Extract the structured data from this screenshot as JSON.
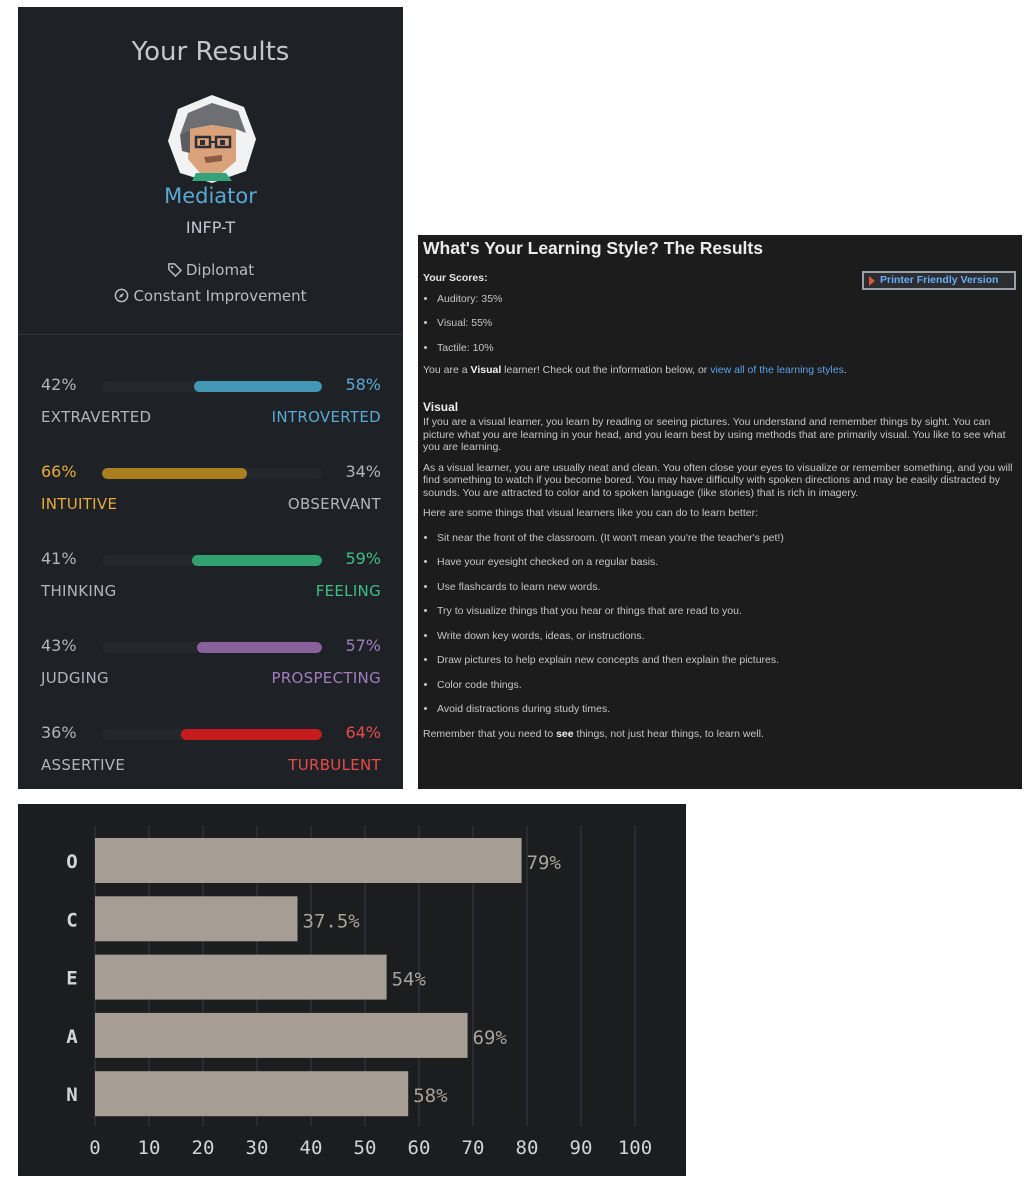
{
  "personality_card": {
    "title": "Your Results",
    "type_name": "Mediator",
    "type_code": "INFP-T",
    "role": "Diplomat",
    "strategy": "Constant Improvement",
    "traits": [
      {
        "left_pct": "42%",
        "right_pct": "58%",
        "left_label": "EXTRAVERTED",
        "right_label": "INTROVERTED",
        "dominant": "right",
        "value": 58,
        "color": "#4298b4"
      },
      {
        "left_pct": "66%",
        "right_pct": "34%",
        "left_label": "INTUITIVE",
        "right_label": "OBSERVANT",
        "dominant": "left",
        "value": 66,
        "color": "#a97f22"
      },
      {
        "left_pct": "41%",
        "right_pct": "59%",
        "left_label": "THINKING",
        "right_label": "FEELING",
        "dominant": "right",
        "value": 59,
        "color": "#31a26f"
      },
      {
        "left_pct": "43%",
        "right_pct": "57%",
        "left_label": "JUDGING",
        "right_label": "PROSPECTING",
        "dominant": "right",
        "value": 57,
        "color": "#88619a"
      },
      {
        "left_pct": "36%",
        "right_pct": "64%",
        "left_label": "ASSERTIVE",
        "right_label": "TURBULENT",
        "dominant": "right",
        "value": 64,
        "color": "#c51d1d"
      }
    ],
    "text_colors": {
      "right": [
        "#59a9d4",
        "#59a9d4",
        "#3fbf83",
        "#a47cbf",
        "#ea4b4b"
      ],
      "left": [
        "#e8ac3a",
        "#e8ac3a",
        "#e8ac3a",
        "#e8ac3a",
        "#e8ac3a"
      ]
    }
  },
  "learning_style": {
    "title": "What's Your Learning Style? The Results",
    "scores_label": "Your Scores:",
    "print_button": "Printer Friendly Version",
    "scores": [
      "Auditory: 35%",
      "Visual: 55%",
      "Tactile: 10%"
    ],
    "result_prefix": "You are a ",
    "result_type": "Visual",
    "result_middle": " learner! Check out the information below, or ",
    "result_link": "view all of the learning styles",
    "result_suffix": ".",
    "section_title": "Visual",
    "para1": "If you are a visual learner, you learn by reading or seeing pictures. You understand and remember things by sight. You can picture what you are learning in your head, and you learn best by using methods that are primarily visual. You like to see what you are learning.",
    "para2": "As a visual learner, you are usually neat and clean. You often close your eyes to visualize or remember something, and you will find something to watch if you become bored. You may have difficulty with spoken directions and may be easily distracted by sounds. You are attracted to color and to spoken language (like stories) that is rich in imagery.",
    "para3": "Here are some things that visual learners like you can do to learn better:",
    "tips": [
      "Sit near the front of the classroom. (It won't mean you're the teacher's pet!)",
      "Have your eyesight checked on a regular basis.",
      "Use flashcards to learn new words.",
      "Try to visualize things that you hear or things that are read to you.",
      "Write down key words, ideas, or instructions.",
      "Draw pictures to help explain new concepts and then explain the pictures.",
      "Color code things.",
      "Avoid distractions during study times."
    ],
    "closing_prefix": "Remember that you need to ",
    "closing_bold": "see",
    "closing_suffix": " things, not just hear things, to learn well."
  },
  "chart_data": {
    "type": "bar",
    "orientation": "horizontal",
    "categories": [
      "O",
      "C",
      "E",
      "A",
      "N"
    ],
    "values": [
      79,
      37.5,
      54,
      69,
      58
    ],
    "data_labels": [
      "79%",
      "37.5%",
      "54%",
      "69%",
      "58%"
    ],
    "xlim": [
      0,
      100
    ],
    "xticks": [
      0,
      10,
      20,
      30,
      40,
      50,
      60,
      70,
      80,
      90,
      100
    ],
    "grid": true,
    "bar_color": "#a69e94",
    "background": "#1c1d1f"
  }
}
